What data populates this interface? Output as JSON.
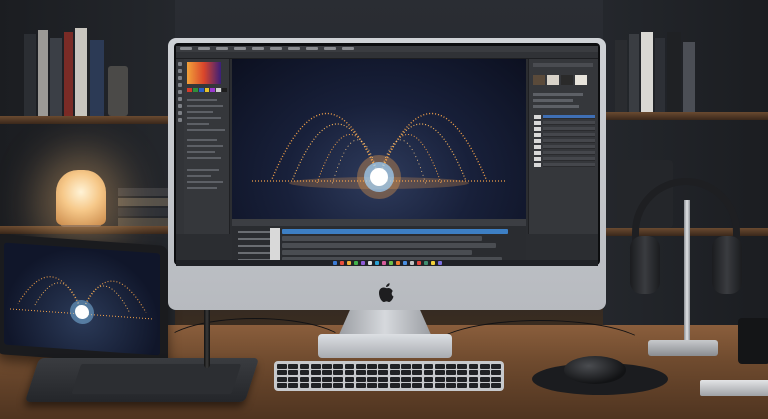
{
  "screen": {
    "app": "video editor",
    "menus": [
      "",
      "",
      "",
      "",
      "",
      "",
      "",
      "",
      "",
      ""
    ],
    "left_panel": {
      "swatch_colors": [
        "#d23a2a",
        "#2f8f3a",
        "#2a5ec8",
        "#e6c32a",
        "#9b3ad2",
        "#d0d0d0",
        "#1d1d1d"
      ]
    },
    "right_panel": {
      "layer_count": 9,
      "selected_layer_index": 0
    },
    "timeline": {
      "track_count": 5
    },
    "taskbar_colors": [
      "#3a7bd5",
      "#e94e3c",
      "#f2b33a",
      "#3fb24a",
      "#8e5bd6",
      "#e0e0e0",
      "#2ba3d6",
      "#d65c9b",
      "#6ac04a",
      "#f07d2b",
      "#4a90e2",
      "#c3c3c3",
      "#e8453c",
      "#3e8e6f",
      "#f2d13a",
      "#7b6fe0"
    ]
  },
  "scene": {
    "accent": "#f6a24a",
    "glow": "#ffffff"
  },
  "icons": {
    "apple_logo": "apple-logo-icon"
  }
}
